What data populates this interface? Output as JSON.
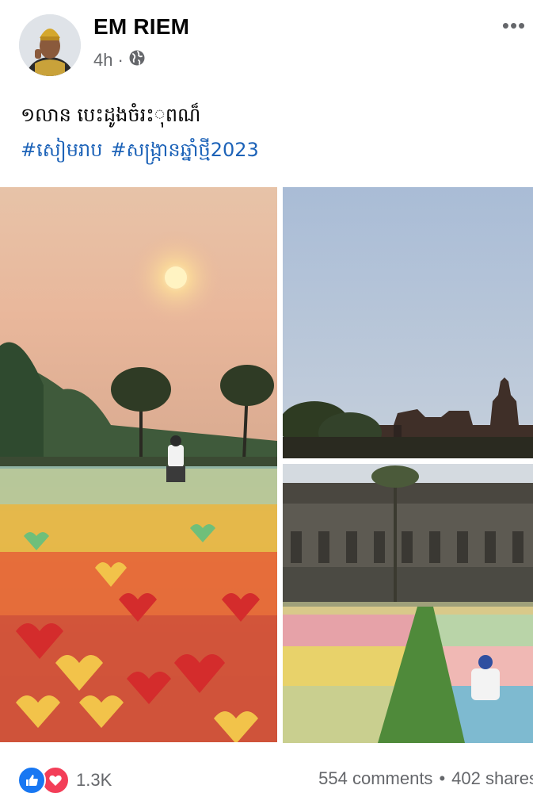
{
  "post": {
    "author": "EM RIEM",
    "time": "4h",
    "time_separator": "·",
    "audience_icon": "globe-icon",
    "more_label": "•••",
    "caption": "១លាន បេះដូងចំរះុពណ៏",
    "hashtags": [
      "#សៀមរាប",
      "#សង្ក្រានឆ្នាំថ្មី2023"
    ]
  },
  "photos": [
    {
      "name": "sunset-paper-hearts-field"
    },
    {
      "name": "angkor-wat-towers"
    },
    {
      "name": "angkor-gallery-pinwheel-field"
    }
  ],
  "footer": {
    "reaction_icons": [
      "like-icon",
      "love-icon"
    ],
    "reaction_count": "1.3K",
    "comments": "554 comments",
    "separator": "•",
    "shares": "402 shares"
  },
  "colors": {
    "link": "#1d63b8",
    "meta": "#65676b",
    "like": "#1877f2",
    "love": "#f33e58"
  }
}
